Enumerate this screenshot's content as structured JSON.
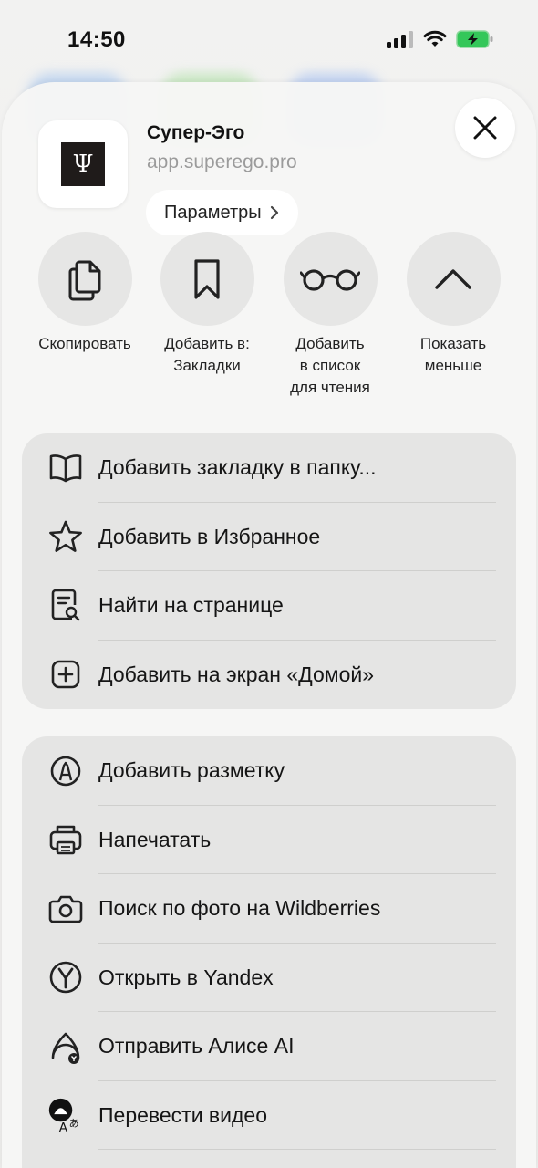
{
  "status_bar": {
    "time": "14:50"
  },
  "header": {
    "app_title": "Супер-Эго",
    "app_url": "app.superego.pro",
    "logo_glyph": "Ψ",
    "options_label": "Параметры",
    "options_chevron": "›"
  },
  "actions": [
    {
      "icon": "copy-icon",
      "label_line1": "Скопировать",
      "label_line2": "",
      "label_line3": ""
    },
    {
      "icon": "bookmark-icon",
      "label_line1": "Добавить в:",
      "label_line2": "Закладки",
      "label_line3": ""
    },
    {
      "icon": "glasses-icon",
      "label_line1": "Добавить",
      "label_line2": "в список",
      "label_line3": "для чтения"
    },
    {
      "icon": "chevron-up-icon",
      "label_line1": "Показать",
      "label_line2": "меньше",
      "label_line3": ""
    }
  ],
  "group1": [
    {
      "icon": "book-icon",
      "label": "Добавить закладку в папку..."
    },
    {
      "icon": "star-icon",
      "label": "Добавить в Избранное"
    },
    {
      "icon": "find-in-page-icon",
      "label": "Найти на странице"
    },
    {
      "icon": "plus-square-icon",
      "label": "Добавить на экран «Домой»"
    }
  ],
  "group2": [
    {
      "icon": "markup-icon",
      "label": "Добавить разметку"
    },
    {
      "icon": "printer-icon",
      "label": "Напечатать"
    },
    {
      "icon": "camera-icon",
      "label": "Поиск по фото на Wildberries"
    },
    {
      "icon": "yandex-icon",
      "label": "Открыть в Yandex"
    },
    {
      "icon": "alice-icon",
      "label": "Отправить Алисе AI"
    },
    {
      "icon": "translate-video-icon",
      "label": "Перевести видео"
    }
  ]
}
